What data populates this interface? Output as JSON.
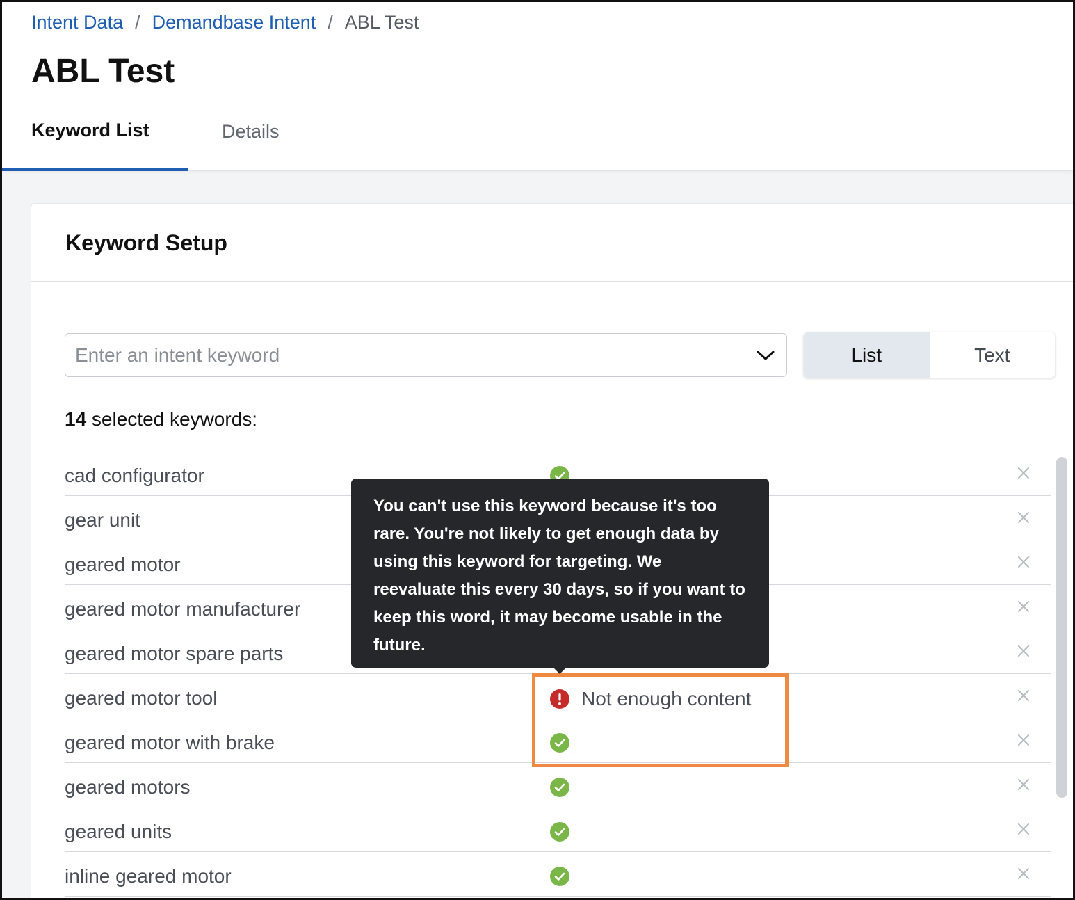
{
  "breadcrumb": {
    "items": [
      "Intent Data",
      "Demandbase Intent"
    ],
    "separator": "/",
    "current": "ABL Test"
  },
  "page": {
    "title": "ABL Test"
  },
  "tabs": {
    "keyword_list": "Keyword List",
    "details": "Details",
    "active": "Keyword List"
  },
  "keyword_setup": {
    "title": "Keyword Setup",
    "search": {
      "placeholder": "Enter an intent keyword",
      "value": ""
    },
    "view_toggle": {
      "list": "List",
      "text": "Text",
      "selected": "List"
    },
    "count": {
      "number": "14",
      "suffix": " selected keywords:"
    },
    "keywords": [
      {
        "name": "cad configurator",
        "status": "ok",
        "status_text": ""
      },
      {
        "name": "gear unit",
        "status": "ok",
        "status_text": ""
      },
      {
        "name": "geared motor",
        "status": "ok",
        "status_text": ""
      },
      {
        "name": "geared motor manufacturer",
        "status": "ok",
        "status_text": ""
      },
      {
        "name": "geared motor spare parts",
        "status": "ok",
        "status_text": ""
      },
      {
        "name": "geared motor tool",
        "status": "error",
        "status_text": "Not enough content"
      },
      {
        "name": "geared motor with brake",
        "status": "ok",
        "status_text": ""
      },
      {
        "name": "geared motors",
        "status": "ok",
        "status_text": ""
      },
      {
        "name": "geared units",
        "status": "ok",
        "status_text": ""
      },
      {
        "name": "inline geared motor",
        "status": "ok",
        "status_text": ""
      }
    ]
  },
  "tooltip": {
    "text": "You can't use this keyword because it's too rare. You're not likely to get enough data by using this keyword for targeting. We reevaluate this every 30 days, so if you want to keep this word, it may become usable in the future."
  },
  "icons": {
    "ok": "check-circle-icon",
    "error": "exclamation-circle-icon",
    "remove": "close-icon",
    "dropdown": "chevron-down-icon"
  },
  "colors": {
    "link": "#1f5fb3",
    "ok": "#7ab648",
    "error": "#c62b2b",
    "highlight": "#ef8a43",
    "tooltip_bg": "#25272b"
  }
}
